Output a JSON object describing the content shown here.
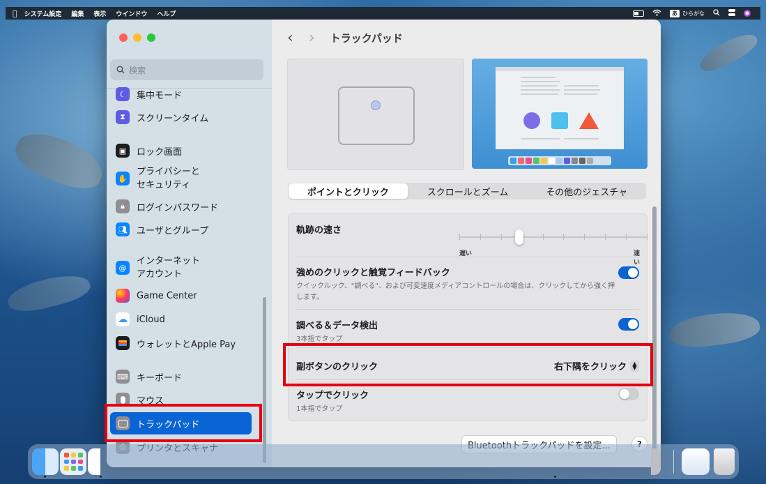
{
  "menubar": {
    "app": "システム設定",
    "items": [
      "編集",
      "表示",
      "ウインドウ",
      "ヘルプ"
    ],
    "input_mode": "あ",
    "input_label": "ひらがな"
  },
  "sidebar": {
    "search_placeholder": "検索",
    "items": [
      {
        "label": "集中モード",
        "icon": "moon-icon",
        "color": "#5e5ce6"
      },
      {
        "label": "スクリーンタイム",
        "icon": "hourglass-icon",
        "color": "#5e5ce6"
      },
      {
        "label": "ロック画面",
        "icon": "lock-screen-icon",
        "color": "#1c1c1e"
      },
      {
        "label": "プライバシーと",
        "label2": "セキュリティ",
        "icon": "hand-icon",
        "color": "#0a84ff"
      },
      {
        "label": "ログインパスワード",
        "icon": "lock-icon",
        "color": "#8e8e93"
      },
      {
        "label": "ユーザとグループ",
        "icon": "users-icon",
        "color": "#0a84ff"
      },
      {
        "label": "インターネット",
        "label2": "アカウント",
        "icon": "at-icon",
        "color": "#0a84ff"
      },
      {
        "label": "Game Center",
        "icon": "game-center-icon",
        "color": "#ff375f"
      },
      {
        "label": "iCloud",
        "icon": "cloud-icon",
        "color": "#ffffff"
      },
      {
        "label": "ウォレットとApple Pay",
        "icon": "wallet-icon",
        "color": "#1c1c1e"
      },
      {
        "label": "キーボード",
        "icon": "keyboard-icon",
        "color": "#8e8e93"
      },
      {
        "label": "マウス",
        "icon": "mouse-icon",
        "color": "#8e8e93"
      },
      {
        "label": "トラックパッド",
        "icon": "trackpad-icon",
        "color": "#8e8e93"
      },
      {
        "label": "プリンタとスキャナ",
        "icon": "printer-icon",
        "color": "#8e8e93"
      }
    ]
  },
  "main": {
    "title": "トラックパッド",
    "tabs": [
      "ポイントとクリック",
      "スクロールとズーム",
      "その他のジェスチャ"
    ],
    "tracking": {
      "label": "軌跡の速さ",
      "min": "遅い",
      "max": "速い",
      "level": 0.31
    },
    "force_click": {
      "label": "強めのクリックと触覚フィードバック",
      "desc": "クイックルック、\"調べる\"、および可変速度メディアコントロールの場合は、クリックしてから強く押します。",
      "on": true
    },
    "lookup": {
      "label": "調べる＆データ検出",
      "desc": "3本指でタップ",
      "on": true
    },
    "secondary": {
      "label": "副ボタンのクリック",
      "value": "右下隅をクリック"
    },
    "tap": {
      "label": "タップでクリック",
      "desc": "1本指でタップ",
      "on": false
    },
    "bt_button": "Bluetoothトラックパッドを設定...",
    "help": "?"
  },
  "colors": {
    "accent": "#0a64d4",
    "highlight": "#e60012"
  }
}
